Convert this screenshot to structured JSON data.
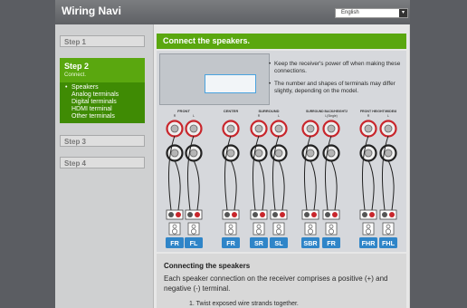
{
  "app": {
    "title": "Wiring Navi"
  },
  "language": {
    "selected": "English"
  },
  "sidebar": {
    "steps": [
      {
        "label": "Step 1"
      },
      {
        "label": "Step 2",
        "subtitle": "Connect."
      },
      {
        "label": "Step 3"
      },
      {
        "label": "Step 4"
      }
    ],
    "sub_items": [
      {
        "label": "Speakers",
        "active": true
      },
      {
        "label": "Analog terminals"
      },
      {
        "label": "Digital terminals"
      },
      {
        "label": "HDMI terminal"
      },
      {
        "label": "Other terminals"
      }
    ]
  },
  "content": {
    "heading": "Connect the speakers.",
    "notes": [
      "Keep the receiver's power off when making these connections.",
      "The number and shapes of terminals may differ slightly, depending on the model."
    ],
    "groups": [
      {
        "title": "FRONT",
        "lr": [
          "R",
          "L"
        ]
      },
      {
        "title": "CENTER",
        "lr": []
      },
      {
        "title": "SURROUND",
        "lr": [
          "R",
          "L"
        ]
      },
      {
        "title": "SURROUND BACK/HEIGHT2",
        "extra": "L(Single)",
        "lr": []
      },
      {
        "title": "FRONT HEIGHT/WIDE/8",
        "lr": [
          "R",
          "L"
        ]
      }
    ],
    "speakers": [
      "FR",
      "FL",
      "FR",
      "SR",
      "SL",
      "SBR",
      "FR",
      "FHR",
      "FHL"
    ],
    "section_title": "Connecting the speakers",
    "section_body": "Each speaker connection on the receiver comprises a positive (+) and negative (-) terminal.",
    "section_step": "1. Twist exposed wire strands together."
  },
  "colors": {
    "accent_green": "#5aa70f",
    "dark_green": "#3f8b04",
    "speaker_label_blue": "#2f85c8",
    "terminal_red": "#c8262c"
  }
}
